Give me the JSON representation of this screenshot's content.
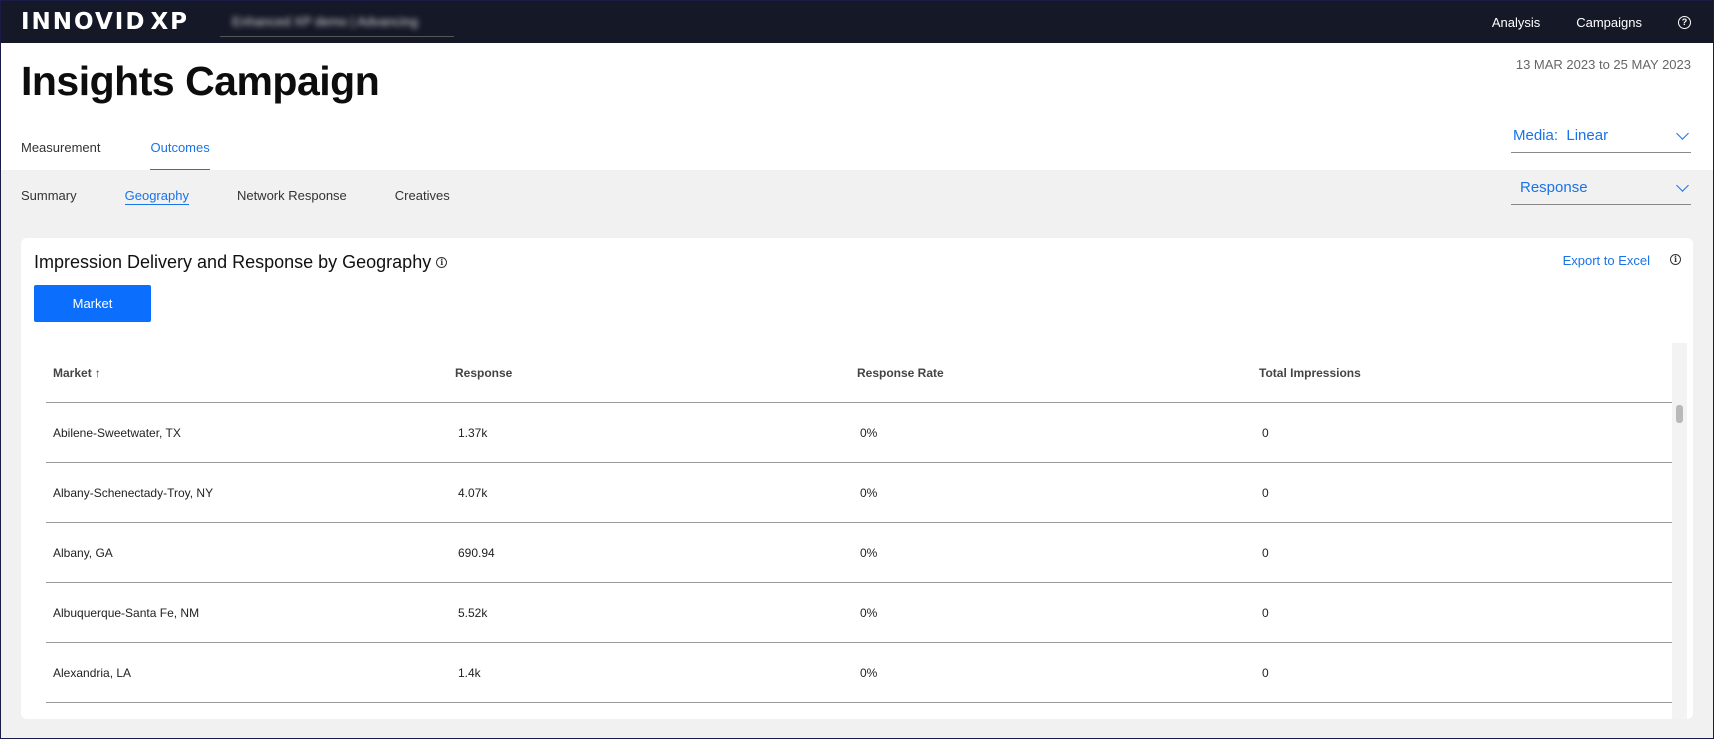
{
  "topbar": {
    "logo_main": "INNOVID",
    "logo_suffix": "XP",
    "campaign_selector": "Enhanced XP demo | Advancing",
    "nav": [
      "Analysis",
      "Campaigns"
    ],
    "help_icon": "question-circle-icon"
  },
  "header": {
    "title": "Insights Campaign",
    "date_range": "13 MAR 2023 to 25 MAY 2023",
    "tabs": [
      {
        "label": "Measurement",
        "active": false
      },
      {
        "label": "Outcomes",
        "active": true
      }
    ],
    "media_dropdown": {
      "label": "Media:",
      "value": "Linear"
    }
  },
  "subnav": {
    "tabs": [
      {
        "label": "Summary",
        "active": false
      },
      {
        "label": "Geography",
        "active": true
      },
      {
        "label": "Network Response",
        "active": false
      },
      {
        "label": "Creatives",
        "active": false
      }
    ],
    "metric_dropdown": {
      "value": "Response"
    }
  },
  "card": {
    "title": "Impression Delivery and Response by Geography",
    "export_label": "Export to Excel",
    "market_button": "Market",
    "table": {
      "columns": [
        "Market",
        "Response",
        "Response Rate",
        "Total Impressions"
      ],
      "sort_indicator": "↑",
      "rows": [
        [
          "Abilene-Sweetwater, TX",
          "1.37k",
          "0%",
          "0"
        ],
        [
          "Albany-Schenectady-Troy, NY",
          "4.07k",
          "0%",
          "0"
        ],
        [
          "Albany, GA",
          "690.94",
          "0%",
          "0"
        ],
        [
          "Albuquerque-Santa Fe, NM",
          "5.52k",
          "0%",
          "0"
        ],
        [
          "Alexandria, LA",
          "1.4k",
          "0%",
          "0"
        ]
      ]
    }
  },
  "colors": {
    "topbar_bg": "#151827",
    "accent": "#1a73e8",
    "button_bg": "#0b6efd",
    "page_bg": "#f1f1f1"
  }
}
